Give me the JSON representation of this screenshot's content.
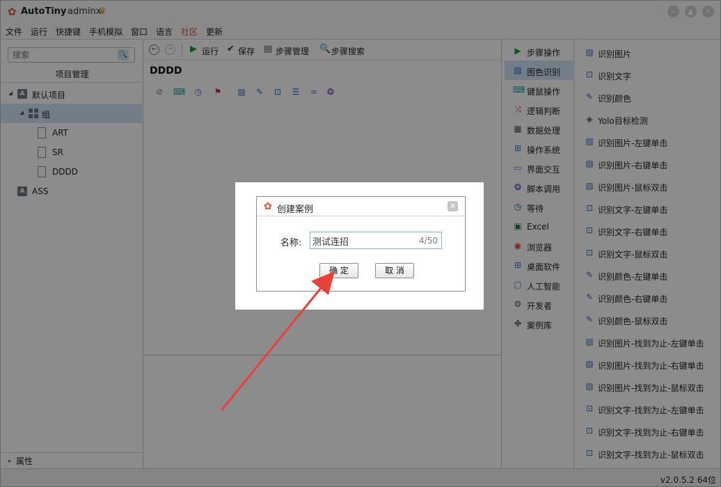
{
  "app": {
    "title": "AutoTiny",
    "user": "adminx",
    "version": "v2.0.5.2 64位"
  },
  "menu": [
    "文件",
    "运行",
    "快捷键",
    "手机模拟",
    "窗口",
    "语言",
    "社区",
    "更新"
  ],
  "left_panel": {
    "search_placeholder": "搜索",
    "title": "项目管理",
    "tree": [
      {
        "label": "默认项目",
        "icon": "project-icon"
      },
      {
        "label": "组",
        "icon": "group-icon"
      },
      {
        "label": "ART",
        "icon": "document-icon"
      },
      {
        "label": "SR",
        "icon": "document-icon"
      },
      {
        "label": "DDDD",
        "icon": "document-icon"
      },
      {
        "label": "ASS",
        "icon": "project-icon"
      }
    ],
    "bottom_label": "属性"
  },
  "toolbar": {
    "run": "运行",
    "save": "保存",
    "steps_manage": "步骤管理",
    "steps_search": "步骤搜索"
  },
  "document": {
    "title": "DDDD"
  },
  "categories": [
    {
      "label": "步骤操作",
      "icon": "play-icon",
      "color": "#1f9a3a"
    },
    {
      "label": "图色识别",
      "icon": "image-icon",
      "color": "#2f6fc4"
    },
    {
      "label": "键鼠操作",
      "icon": "keyboard-icon",
      "color": "#1f9aa8"
    },
    {
      "label": "逻辑判断",
      "icon": "shuffle-icon",
      "color": "#c0304a"
    },
    {
      "label": "数据处理",
      "icon": "data-icon",
      "color": "#555555"
    },
    {
      "label": "操作系统",
      "icon": "windows-icon",
      "color": "#3b78c9"
    },
    {
      "label": "界面交互",
      "icon": "chat-icon",
      "color": "#3b78c9"
    },
    {
      "label": "脚本调用",
      "icon": "csharp-icon",
      "color": "#6a3cb5"
    },
    {
      "label": "等待",
      "icon": "clock-icon",
      "color": "#2f5fa8"
    },
    {
      "label": "Excel",
      "icon": "excel-icon",
      "color": "#1d7a3e"
    },
    {
      "label": "浏览器",
      "icon": "chrome-icon",
      "color": "#d24434"
    },
    {
      "label": "桌面软件",
      "icon": "windows-icon",
      "color": "#3b78c9"
    },
    {
      "label": "人工智能",
      "icon": "ai-icon",
      "color": "#1f7fa8"
    },
    {
      "label": "开发者",
      "icon": "developer-icon",
      "color": "#555555"
    },
    {
      "label": "案例库",
      "icon": "library-icon",
      "color": "#555555"
    }
  ],
  "actions": [
    {
      "label": "识别图片",
      "icon": "image-icon"
    },
    {
      "label": "识别文字",
      "icon": "text-recognize-icon"
    },
    {
      "label": "识别颜色",
      "icon": "eyedropper-icon"
    },
    {
      "label": "Yolo目标检测",
      "icon": "yolo-icon"
    },
    {
      "label": "识别图片-左键单击",
      "icon": "image-icon"
    },
    {
      "label": "识别图片-右键单击",
      "icon": "image-icon"
    },
    {
      "label": "识别图片-鼠标双击",
      "icon": "image-icon"
    },
    {
      "label": "识别文字-左键单击",
      "icon": "text-recognize-icon"
    },
    {
      "label": "识别文字-右键单击",
      "icon": "text-recognize-icon"
    },
    {
      "label": "识别文字-鼠标双击",
      "icon": "text-recognize-icon"
    },
    {
      "label": "识别颜色-左键单击",
      "icon": "eyedropper-icon"
    },
    {
      "label": "识别颜色-右键单击",
      "icon": "eyedropper-icon"
    },
    {
      "label": "识别颜色-鼠标双击",
      "icon": "eyedropper-icon"
    },
    {
      "label": "识别图片-找到为止-左键单击",
      "icon": "image-icon"
    },
    {
      "label": "识别图片-找到为止-右键单击",
      "icon": "image-icon"
    },
    {
      "label": "识别图片-找到为止-鼠标双击",
      "icon": "image-icon"
    },
    {
      "label": "识别文字-找到为止-左键单击",
      "icon": "text-recognize-icon"
    },
    {
      "label": "识别文字-找到为止-右键单击",
      "icon": "text-recognize-icon"
    },
    {
      "label": "识别文字-找到为止-鼠标双击",
      "icon": "text-recognize-icon"
    }
  ],
  "dialog": {
    "title": "创建案例",
    "name_label": "名称:",
    "name_value": "测试连招",
    "char_count": "4/50",
    "ok": "确 定",
    "cancel": "取 消"
  },
  "colors": {
    "accent": "#d9532a",
    "selection": "#cfe3f7",
    "annotation_arrow": "#e8413a"
  }
}
